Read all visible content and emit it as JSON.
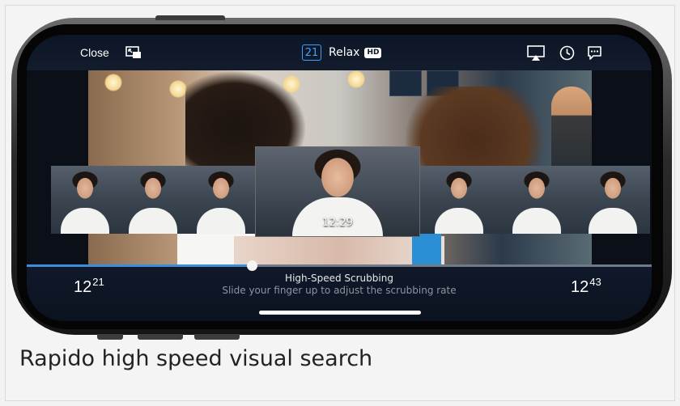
{
  "topbar": {
    "close_label": "Close",
    "channel_number": "21",
    "channel_name": "Relax",
    "quality_badge": "HD",
    "icons": [
      "picture-in-picture-icon",
      "airplay-icon",
      "clock-icon",
      "chat-icon"
    ]
  },
  "thumbnail_strip": {
    "focused_time": "12:29"
  },
  "scrubber": {
    "start_hour": "12",
    "start_minute": "21",
    "end_hour": "12",
    "end_minute": "43",
    "progress_fraction": 0.36,
    "title": "High-Speed Scrubbing",
    "hint": "Slide your finger up to adjust the scrubbing rate"
  },
  "caption": "Rapido high speed visual search",
  "colors": {
    "accent": "#3da2ff",
    "bar_background": "#10192a",
    "progress": "#3a8edb"
  }
}
